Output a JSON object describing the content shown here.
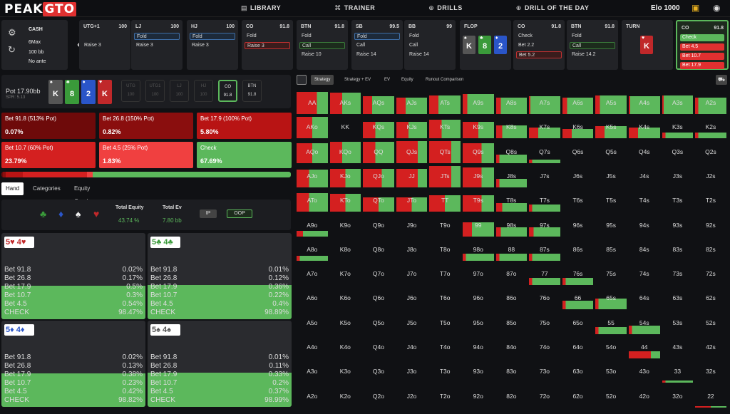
{
  "nav": {
    "logo_a": "PEAK",
    "logo_b": "GTO",
    "library": "LIBRARY",
    "trainer": "TRAINER",
    "drills": "DRILLS",
    "dotd": "DRILL OF THE DAY",
    "elo": "Elo 1000"
  },
  "info": {
    "game": "CASH",
    "format": "6Max",
    "stack": "100 bb",
    "ante": "No ante"
  },
  "actions": [
    {
      "pos": "UTG+1",
      "stack": "100",
      "lines": [
        {
          "t": "",
          "c": ""
        },
        {
          "t": "Raise 3",
          "c": ""
        }
      ]
    },
    {
      "pos": "LJ",
      "stack": "100",
      "lines": [
        {
          "t": "Fold",
          "c": "blue"
        },
        {
          "t": "Raise 3",
          "c": ""
        }
      ]
    },
    {
      "pos": "HJ",
      "stack": "100",
      "lines": [
        {
          "t": "Fold",
          "c": "blue"
        },
        {
          "t": "Raise 3",
          "c": ""
        }
      ]
    },
    {
      "pos": "CO",
      "stack": "91.8",
      "lines": [
        {
          "t": "Fold",
          "c": ""
        },
        {
          "t": "Raise 3",
          "c": "red"
        }
      ]
    },
    {
      "pos": "BTN",
      "stack": "91.8",
      "lines": [
        {
          "t": "Fold",
          "c": ""
        },
        {
          "t": "Call",
          "c": "green"
        },
        {
          "t": "Raise 10",
          "c": ""
        }
      ]
    },
    {
      "pos": "SB",
      "stack": "99.5",
      "lines": [
        {
          "t": "Fold",
          "c": "blue"
        },
        {
          "t": "Call",
          "c": ""
        },
        {
          "t": "Raise 14",
          "c": ""
        }
      ]
    },
    {
      "pos": "BB",
      "stack": "99",
      "lines": [
        {
          "t": "Fold",
          "c": ""
        },
        {
          "t": "Call",
          "c": ""
        },
        {
          "t": "Raise 14",
          "c": ""
        }
      ]
    },
    {
      "pos": "FLOP",
      "stack": "",
      "lines": []
    },
    {
      "pos": "CO",
      "stack": "91.8",
      "lines": [
        {
          "t": "Check",
          "c": ""
        },
        {
          "t": "Bet 2.2",
          "c": ""
        },
        {
          "t": "Bet 5.2",
          "c": "red"
        }
      ]
    },
    {
      "pos": "BTN",
      "stack": "91.8",
      "lines": [
        {
          "t": "Fold",
          "c": ""
        },
        {
          "t": "Call",
          "c": "green"
        },
        {
          "t": "Raise 14.2",
          "c": ""
        }
      ]
    },
    {
      "pos": "TURN",
      "stack": "",
      "lines": []
    }
  ],
  "current": {
    "pos": "CO",
    "stack": "91.8",
    "lines": [
      "Check",
      "Bet 4.5",
      "Bet 10.7",
      "Bet 17.9"
    ]
  },
  "flop_cards": [
    {
      "r": "K",
      "s": "♠",
      "col": "#555"
    },
    {
      "r": "8",
      "s": "♣",
      "col": "#3a9a3a"
    },
    {
      "r": "2",
      "s": "♦",
      "col": "#2a55c8"
    }
  ],
  "turn_card": {
    "r": "K",
    "s": "♥",
    "col": "#c0282a"
  },
  "board": [
    {
      "r": "K",
      "s": "♠",
      "col": "#555"
    },
    {
      "r": "8",
      "s": "♣",
      "col": "#3a9a3a"
    },
    {
      "r": "2",
      "s": "♦",
      "col": "#2a55c8"
    },
    {
      "r": "K",
      "s": "♥",
      "col": "#c0282a"
    }
  ],
  "pot": {
    "label": "Pot",
    "value": "17.90bb",
    "spr": "SPR: 5.13"
  },
  "seats": [
    {
      "n": "UTG",
      "v": "100"
    },
    {
      "n": "UTG1",
      "v": "100"
    },
    {
      "n": "LJ",
      "v": "100"
    },
    {
      "n": "HJ",
      "v": "100"
    },
    {
      "n": "CO",
      "v": "91.8"
    },
    {
      "n": "BTN",
      "v": "91.8"
    }
  ],
  "bets": [
    {
      "label": "Bet 91.8 (513% Pot)",
      "pct": "0.07%",
      "col": "#6e0a0a"
    },
    {
      "label": "Bet 26.8 (150% Pot)",
      "pct": "0.82%",
      "col": "#8a0e0e"
    },
    {
      "label": "Bet 17.9 (100% Pot)",
      "pct": "5.80%",
      "col": "#b81414"
    },
    {
      "label": "Bet 10.7 (60% Pot)",
      "pct": "23.79%",
      "col": "#d42020"
    },
    {
      "label": "Bet 4.5 (25% Pot)",
      "pct": "1.83%",
      "col": "#f04040"
    },
    {
      "label": "Check",
      "pct": "67.69%",
      "col": "#5cb85c"
    }
  ],
  "tabs": {
    "hand": "Hand",
    "categories": "Categories",
    "equity_graph": "Equity Graph"
  },
  "equity": {
    "te_label": "Total Equity",
    "te": "43.74 %",
    "ev_label": "Total Ev",
    "ev": "7.80 bb",
    "ip": "IP",
    "oop": "OOP"
  },
  "combos": [
    {
      "h": "5♥ 4♥",
      "col": "#c0282a",
      "rows": [
        [
          "Bet 91.8",
          "0.02%"
        ],
        [
          "Bet 26.8",
          "0.17%"
        ],
        [
          "Bet 17.9",
          "0.5%"
        ],
        [
          "Bet 10.7",
          "0.3%"
        ],
        [
          "Bet 4.5",
          "0.54%"
        ],
        [
          "CHECK",
          "98.47%"
        ]
      ],
      "fill": 0.98
    },
    {
      "h": "5♣ 4♣",
      "col": "#3a9a3a",
      "rows": [
        [
          "Bet 91.8",
          "0.01%"
        ],
        [
          "Bet 26.8",
          "0.12%"
        ],
        [
          "Bet 17.9",
          "0.36%"
        ],
        [
          "Bet 10.7",
          "0.22%"
        ],
        [
          "Bet 4.5",
          "0.4%"
        ],
        [
          "CHECK",
          "98.89%"
        ]
      ],
      "fill": 0.99
    },
    {
      "h": "5♦ 4♦",
      "col": "#2a55c8",
      "rows": [
        [
          "Bet 91.8",
          "0.02%"
        ],
        [
          "Bet 26.8",
          "0.13%"
        ],
        [
          "Bet 17.9",
          "0.38%"
        ],
        [
          "Bet 10.7",
          "0.23%"
        ],
        [
          "Bet 4.5",
          "0.42%"
        ],
        [
          "CHECK",
          "98.82%"
        ]
      ],
      "fill": 0.98
    },
    {
      "h": "5♠ 4♠",
      "col": "#555",
      "rows": [
        [
          "Bet 91.8",
          "0.01%"
        ],
        [
          "Bet 26.8",
          "0.11%"
        ],
        [
          "Bet 17.9",
          "0.33%"
        ],
        [
          "Bet 10.7",
          "0.2%"
        ],
        [
          "Bet 4.5",
          "0.37%"
        ],
        [
          "CHECK",
          "98.99%"
        ]
      ],
      "fill": 0.99
    }
  ],
  "strategy_tabs": [
    "Strategy",
    "Strategy + EV",
    "EV",
    "Equity",
    "Runout Comparison"
  ],
  "ranks": [
    "A",
    "K",
    "Q",
    "J",
    "T",
    "9",
    "8",
    "7",
    "6",
    "5",
    "4",
    "3",
    "2"
  ],
  "grid_freq": [
    [
      [
        0.95,
        0.35
      ],
      [
        0.9,
        0.6
      ],
      [
        0.75,
        0.7
      ],
      [
        0.7,
        0.7
      ],
      [
        0.8,
        0.7
      ],
      [
        0.85,
        0.85
      ],
      [
        0.7,
        0.85
      ],
      [
        0.75,
        0.95
      ],
      [
        0.7,
        0.85
      ],
      [
        0.8,
        0.85
      ],
      [
        0.75,
        0.95
      ],
      [
        0.8,
        0.95
      ],
      [
        0.7,
        0.9
      ]
    ],
    [
      [
        0.9,
        0.5
      ],
      [
        0,
        0
      ],
      [
        0.7,
        0.6
      ],
      [
        0.7,
        0.6
      ],
      [
        0.8,
        0.6
      ],
      [
        0.7,
        0.5
      ],
      [
        0.55,
        0.8
      ],
      [
        0.45,
        0.7
      ],
      [
        0.4,
        0.7
      ],
      [
        0.5,
        0.7
      ],
      [
        0.45,
        0.7
      ],
      [
        0.25,
        0.9
      ],
      [
        0.25,
        0.9
      ]
    ],
    [
      [
        0.85,
        0.5
      ],
      [
        0.9,
        0.6
      ],
      [
        0.9,
        0.6
      ],
      [
        0.95,
        0.3
      ],
      [
        0.95,
        0.3
      ],
      [
        0.85,
        0.4
      ],
      [
        0.35,
        0.9
      ],
      [
        0.15,
        0.9
      ],
      [
        0,
        0
      ],
      [
        0,
        0
      ],
      [
        0,
        0
      ],
      [
        0,
        0
      ],
      [
        0,
        0
      ]
    ],
    [
      [
        0.75,
        0.6
      ],
      [
        0.8,
        0.5
      ],
      [
        0.8,
        0.4
      ],
      [
        0.8,
        0.3
      ],
      [
        0.9,
        0.3
      ],
      [
        0.85,
        0.4
      ],
      [
        0.35,
        0.9
      ],
      [
        0,
        0
      ],
      [
        0,
        0
      ],
      [
        0,
        0
      ],
      [
        0,
        0
      ],
      [
        0,
        0
      ],
      [
        0,
        0
      ]
    ],
    [
      [
        0.8,
        0.6
      ],
      [
        0.75,
        0.5
      ],
      [
        0.6,
        0.5
      ],
      [
        0.6,
        0.5
      ],
      [
        0.7,
        0.5
      ],
      [
        0.7,
        0.4
      ],
      [
        0.35,
        0.8
      ],
      [
        0.3,
        0.9
      ],
      [
        0,
        0
      ],
      [
        0,
        0
      ],
      [
        0,
        0
      ],
      [
        0,
        0
      ],
      [
        0,
        0
      ]
    ],
    [
      [
        0.25,
        0.8
      ],
      [
        0,
        0
      ],
      [
        0,
        0
      ],
      [
        0,
        0
      ],
      [
        0,
        0
      ],
      [
        0.6,
        0.7
      ],
      [
        0.4,
        0.85
      ],
      [
        0.4,
        0.85
      ],
      [
        0,
        0
      ],
      [
        0,
        0
      ],
      [
        0,
        0
      ],
      [
        0,
        0
      ],
      [
        0,
        0
      ]
    ],
    [
      [
        0.2,
        0.9
      ],
      [
        0,
        0
      ],
      [
        0,
        0
      ],
      [
        0,
        0
      ],
      [
        0,
        0
      ],
      [
        0.3,
        0.9
      ],
      [
        0.3,
        0.9
      ],
      [
        0.3,
        0.9
      ],
      [
        0,
        0
      ],
      [
        0,
        0
      ],
      [
        0,
        0
      ],
      [
        0,
        0
      ],
      [
        0,
        0
      ]
    ],
    [
      [
        0,
        0
      ],
      [
        0,
        0
      ],
      [
        0,
        0
      ],
      [
        0,
        0
      ],
      [
        0,
        0
      ],
      [
        0,
        0
      ],
      [
        0,
        0
      ],
      [
        0.3,
        0.9
      ],
      [
        0.3,
        0.9
      ],
      [
        0,
        0
      ],
      [
        0,
        0
      ],
      [
        0,
        0
      ],
      [
        0,
        0
      ]
    ],
    [
      [
        0,
        0
      ],
      [
        0,
        0
      ],
      [
        0,
        0
      ],
      [
        0,
        0
      ],
      [
        0,
        0
      ],
      [
        0,
        0
      ],
      [
        0,
        0
      ],
      [
        0,
        0
      ],
      [
        0.35,
        0.9
      ],
      [
        0.45,
        0.9
      ],
      [
        0,
        0
      ],
      [
        0,
        0
      ],
      [
        0,
        0
      ]
    ],
    [
      [
        0,
        0
      ],
      [
        0,
        0
      ],
      [
        0,
        0
      ],
      [
        0,
        0
      ],
      [
        0,
        0
      ],
      [
        0,
        0
      ],
      [
        0,
        0
      ],
      [
        0,
        0
      ],
      [
        0,
        0
      ],
      [
        0.3,
        0.9
      ],
      [
        0.35,
        0.9
      ],
      [
        0,
        0
      ],
      [
        0,
        0
      ]
    ],
    [
      [
        0,
        0
      ],
      [
        0,
        0
      ],
      [
        0,
        0
      ],
      [
        0,
        0
      ],
      [
        0,
        0
      ],
      [
        0,
        0
      ],
      [
        0,
        0
      ],
      [
        0,
        0
      ],
      [
        0,
        0
      ],
      [
        0,
        0
      ],
      [
        0.3,
        0.3
      ],
      [
        0,
        0
      ],
      [
        0,
        0
      ]
    ],
    [
      [
        0,
        0
      ],
      [
        0,
        0
      ],
      [
        0,
        0
      ],
      [
        0,
        0
      ],
      [
        0,
        0
      ],
      [
        0,
        0
      ],
      [
        0,
        0
      ],
      [
        0,
        0
      ],
      [
        0,
        0
      ],
      [
        0,
        0
      ],
      [
        0,
        0
      ],
      [
        0.1,
        0.9
      ],
      [
        0,
        0
      ]
    ],
    [
      [
        0,
        0
      ],
      [
        0,
        0
      ],
      [
        0,
        0
      ],
      [
        0,
        0
      ],
      [
        0,
        0
      ],
      [
        0,
        0
      ],
      [
        0,
        0
      ],
      [
        0,
        0
      ],
      [
        0,
        0
      ],
      [
        0,
        0
      ],
      [
        0,
        0
      ],
      [
        0,
        0
      ],
      [
        0.05,
        0.5
      ]
    ]
  ],
  "colors": {
    "green": "#5cb85c",
    "red": "#d42020",
    "panel": "#222327"
  }
}
